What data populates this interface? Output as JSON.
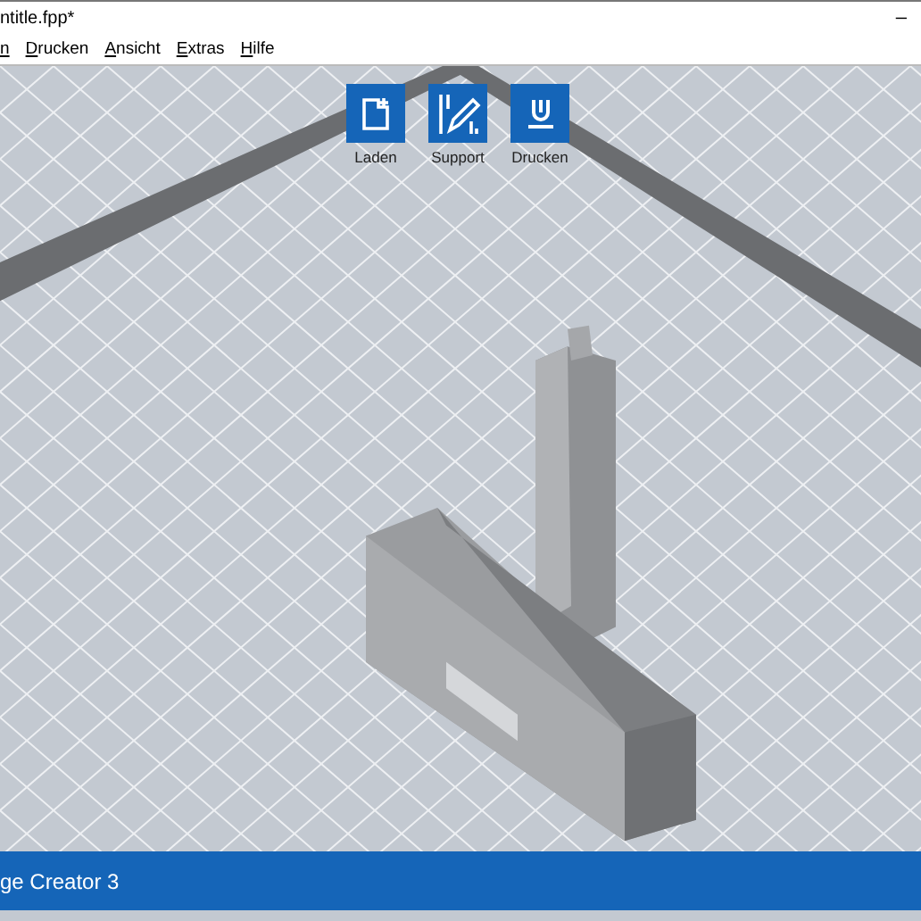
{
  "window": {
    "title": "ntitle.fpp*",
    "minimize": "–"
  },
  "menu": [
    "n",
    "Drucken",
    "Ansicht",
    "Extras",
    "Hilfe"
  ],
  "toolbar": [
    {
      "kind": "load",
      "label": "Laden"
    },
    {
      "kind": "support",
      "label": "Support"
    },
    {
      "kind": "print",
      "label": "Drucken"
    }
  ],
  "status_bar": {
    "text": "ge Creator 3"
  }
}
